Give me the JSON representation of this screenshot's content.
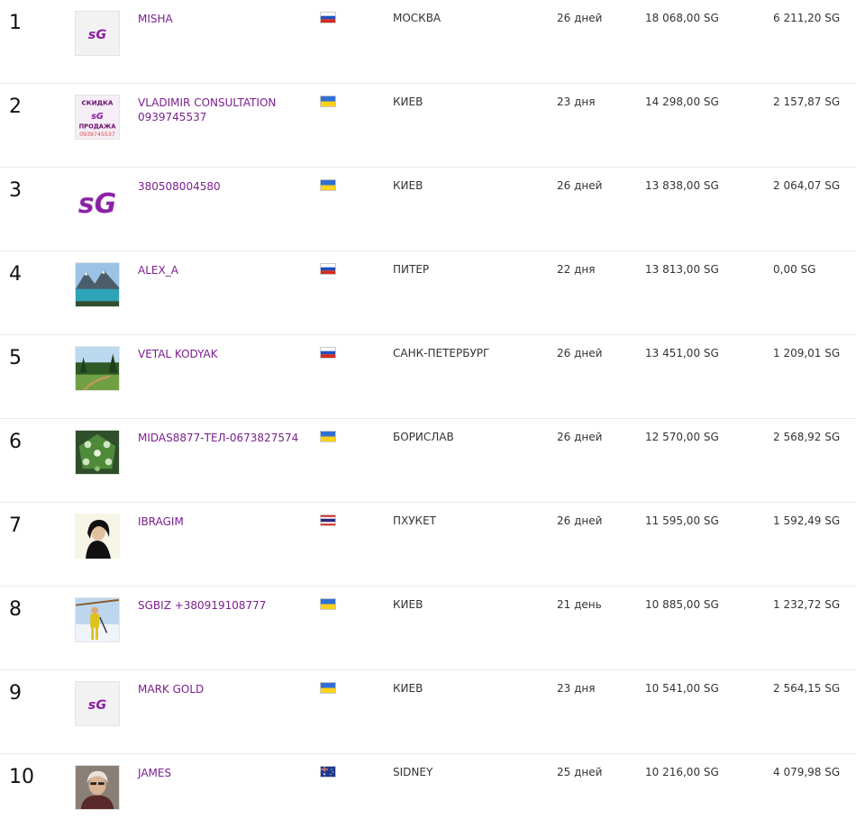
{
  "rows": [
    {
      "rank": "1",
      "name": "MISHA",
      "flag": "russia-flag-icon",
      "avatar": "sg-logo-avatar",
      "city": "МОСКВА",
      "days": "26 дней",
      "total": "18 068,00 SG",
      "bonus": "6 211,20 SG"
    },
    {
      "rank": "2",
      "name": "VLADIMIR CONSULTATION 0939745537",
      "flag": "ukraine-flag-icon",
      "avatar": "promo-sale-avatar",
      "avatar_text_top": "СКИДКА",
      "avatar_text_mid": "ПРОДАЖА",
      "avatar_text_bottom": "0939745537",
      "city": "КИЕВ",
      "days": "23 дня",
      "total": "14 298,00 SG",
      "bonus": "2 157,87 SG"
    },
    {
      "rank": "3",
      "name": "380508004580",
      "flag": "ukraine-flag-icon",
      "avatar": "sg-logo-large-avatar",
      "city": "КИЕВ",
      "days": "26 дней",
      "total": "13 838,00 SG",
      "bonus": "2 064,07 SG"
    },
    {
      "rank": "4",
      "name": "ALEX_A",
      "flag": "russia-flag-icon",
      "avatar": "mountain-lake-avatar",
      "city": "ПИТЕР",
      "days": "22 дня",
      "total": "13 813,00 SG",
      "bonus": "0,00 SG"
    },
    {
      "rank": "5",
      "name": "VETAL KODYAK",
      "flag": "russia-flag-icon",
      "avatar": "forest-field-avatar",
      "city": "САНК-ПЕТЕРБУРГ",
      "days": "26 дней",
      "total": "13 451,00 SG",
      "bonus": "1 209,01 SG"
    },
    {
      "rank": "6",
      "name": "MIDAS8877-ТЕЛ-0673827574",
      "flag": "ukraine-flag-icon",
      "avatar": "green-game-avatar",
      "city": "БОРИСЛАВ",
      "days": "26 дней",
      "total": "12 570,00 SG",
      "bonus": "2 568,92 SG"
    },
    {
      "rank": "7",
      "name": "IBRAGIM",
      "flag": "thailand-flag-icon",
      "avatar": "person-portrait-avatar",
      "city": "ПХУКЕТ",
      "days": "26 дней",
      "total": "11 595,00 SG",
      "bonus": "1 592,49 SG"
    },
    {
      "rank": "8",
      "name": "SGBIZ +380919108777",
      "flag": "ukraine-flag-icon",
      "avatar": "snow-person-avatar",
      "city": "КИЕВ",
      "days": "21 день",
      "total": "10 885,00 SG",
      "bonus": "1 232,72 SG"
    },
    {
      "rank": "9",
      "name": "MARK GOLD",
      "flag": "ukraine-flag-icon",
      "avatar": "sg-logo-avatar",
      "city": "КИЕВ",
      "days": "23 дня",
      "total": "10 541,00 SG",
      "bonus": "2 564,15 SG"
    },
    {
      "rank": "10",
      "name": "JAMES",
      "flag": "australia-flag-icon",
      "avatar": "man-portrait-avatar",
      "city": "SIDNEY",
      "days": "25 дней",
      "total": "10 216,00 SG",
      "bonus": "4 079,98 SG"
    }
  ],
  "colors": {
    "link": "#7b1f8f",
    "text": "#333333",
    "brand": "#8b1fa3"
  }
}
